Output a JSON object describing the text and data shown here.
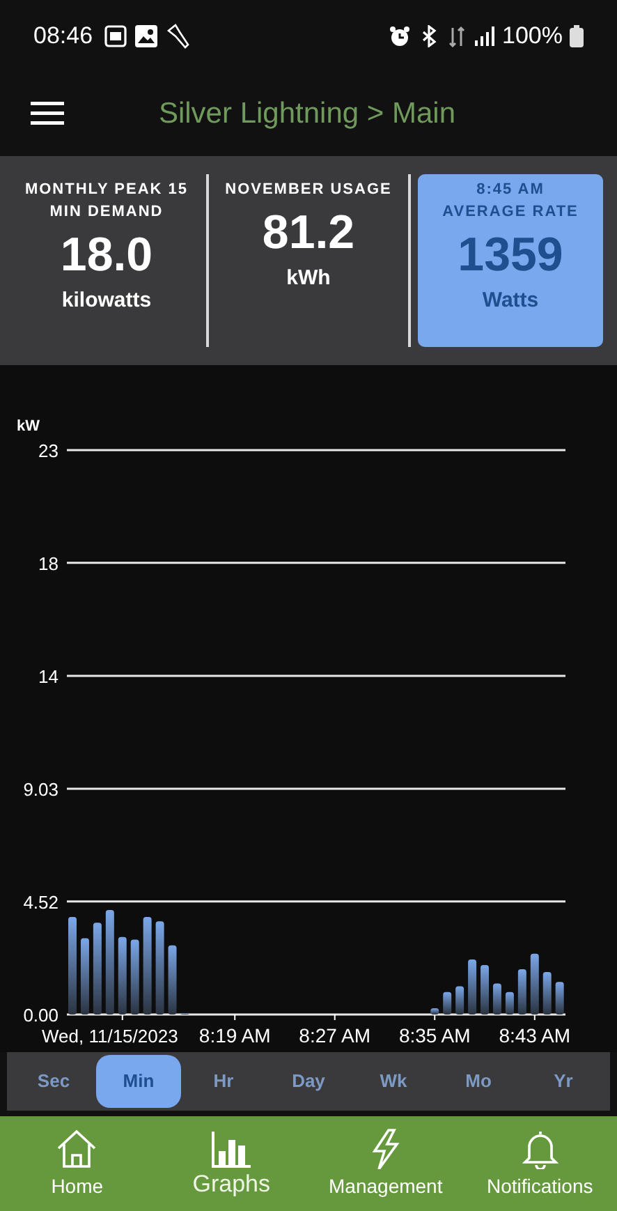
{
  "status_bar": {
    "time": "08:46",
    "battery": "100%"
  },
  "header": {
    "title": "Silver Lightning > Main"
  },
  "stats": [
    {
      "label": "MONTHLY PEAK 15 MIN DEMAND",
      "value": "18.0",
      "unit": "kilowatts",
      "highlighted": false
    },
    {
      "label": "NOVEMBER USAGE",
      "value": "81.2",
      "unit": "kWh",
      "highlighted": false
    },
    {
      "caption": "8:45 AM",
      "label": "AVERAGE RATE",
      "value": "1359",
      "unit": "Watts",
      "highlighted": true
    }
  ],
  "chart": {
    "chart_data": {
      "type": "bar",
      "ylabel": "kW",
      "categories": [
        null,
        null,
        null,
        null,
        "Wed, 11/15/2023",
        null,
        null,
        null,
        null,
        null,
        null,
        null,
        null,
        "8:19 AM",
        null,
        null,
        null,
        null,
        null,
        null,
        null,
        "8:27 AM",
        null,
        null,
        null,
        null,
        null,
        null,
        null,
        "8:35 AM",
        null,
        null,
        null,
        null,
        null,
        null,
        null,
        "8:43 AM",
        null,
        null
      ],
      "grid": true,
      "series": [
        {
          "color": "#7ba7e8",
          "values": [
            3.9,
            3.05,
            3.67,
            4.18,
            3.1,
            3.0,
            3.9,
            3.73,
            2.77,
            0.05,
            0,
            0,
            0,
            0,
            0,
            0,
            0,
            0,
            0,
            0,
            0,
            0,
            0,
            0,
            0,
            0,
            0,
            0,
            0,
            0.25,
            0.9,
            1.13,
            2.2,
            1.98,
            1.24,
            0.9,
            1.81,
            2.43,
            1.7,
            1.3
          ]
        }
      ],
      "ylim": [
        0,
        22.58
      ],
      "yticks": [
        {
          "value": 0,
          "label": "0.00"
        },
        {
          "value": 4.52,
          "label": "4.52"
        },
        {
          "value": 9.03,
          "label": "9.03"
        },
        {
          "value": 13.55,
          "label": "14"
        },
        {
          "value": 18.07,
          "label": "18"
        },
        {
          "value": 22.58,
          "label": "23"
        }
      ]
    }
  },
  "timescale": [
    {
      "label": "Sec",
      "selected": false
    },
    {
      "label": "Min",
      "selected": true
    },
    {
      "label": "Hr",
      "selected": false
    },
    {
      "label": "Day",
      "selected": false
    },
    {
      "label": "Wk",
      "selected": false
    },
    {
      "label": "Mo",
      "selected": false
    },
    {
      "label": "Yr",
      "selected": false
    }
  ],
  "nav": [
    {
      "label": "Home",
      "selected": false
    },
    {
      "label": "Graphs",
      "selected": true
    },
    {
      "label": "Management",
      "selected": false
    },
    {
      "label": "Notifications",
      "selected": false
    }
  ]
}
